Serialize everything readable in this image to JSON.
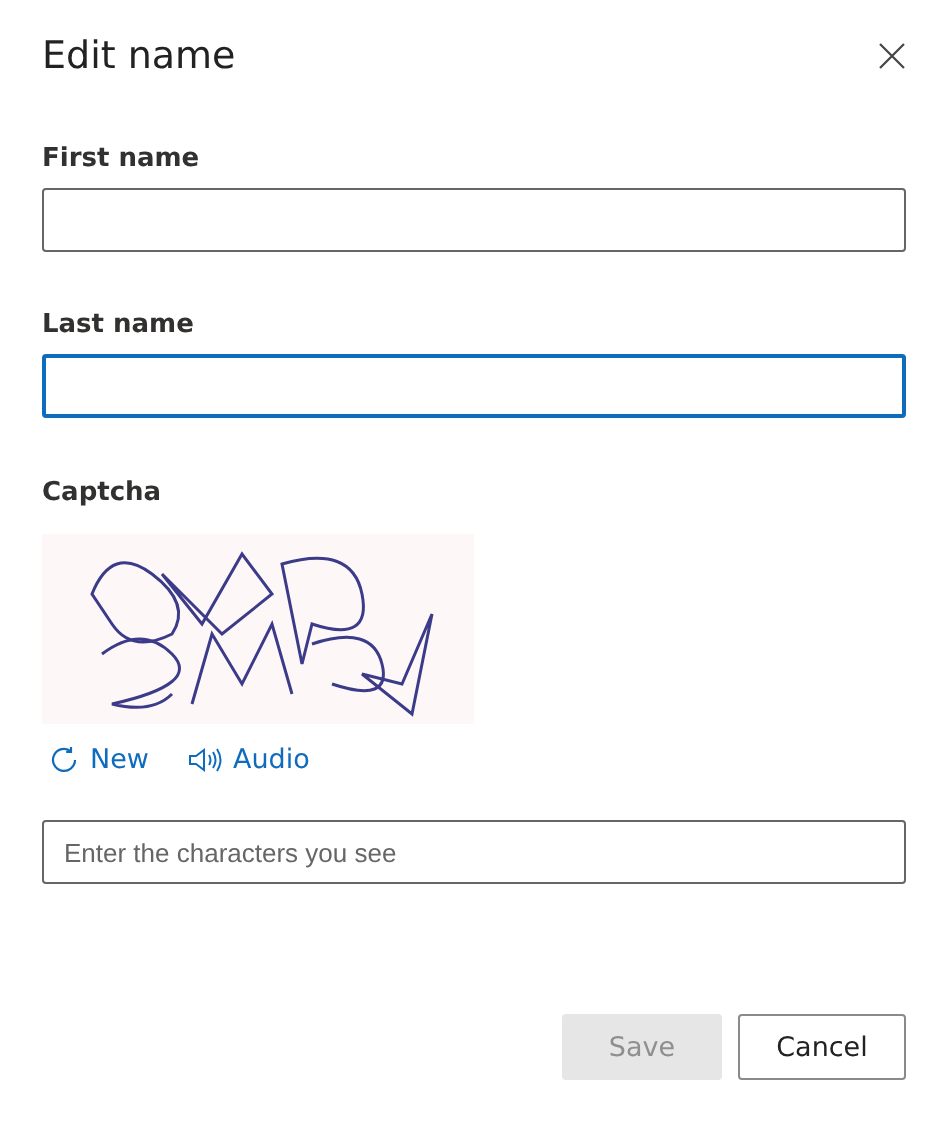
{
  "dialog": {
    "title": "Edit name"
  },
  "fields": [
    {
      "label": "First name",
      "focused": false
    },
    {
      "label": "Last name",
      "focused": true
    }
  ],
  "captcha": {
    "label": "Captcha",
    "actions": [
      {
        "kind": "refresh",
        "label": "New"
      },
      {
        "kind": "audio",
        "label": "Audio"
      }
    ],
    "input": {
      "placeholder": "Enter the characters you see"
    }
  },
  "buttons": [
    {
      "label": "Save",
      "disabled": true
    },
    {
      "label": "Cancel",
      "disabled": false
    }
  ]
}
